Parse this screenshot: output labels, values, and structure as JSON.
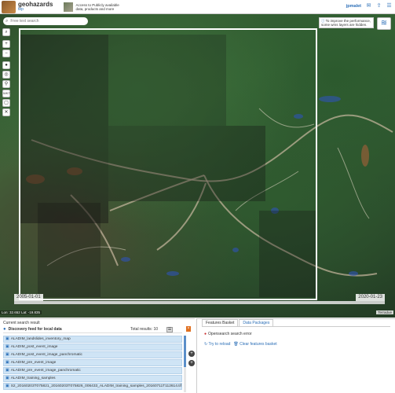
{
  "header": {
    "brand_title": "geohazards",
    "brand_subtitle": "tep",
    "tagline": "Access to Publicly available data, products and more",
    "username": "jpmalet",
    "icons": [
      "envelope-icon",
      "share-icon",
      "menu-icon"
    ]
  },
  "map": {
    "search_placeholder": "Free text search",
    "toolbar": [
      "zoom-in-icon",
      "zoom-out-icon",
      "home-icon",
      "location-icon",
      "marker-icon",
      "wkt-icon",
      "draw-icon",
      "clear-icon"
    ],
    "wkt_label": "WKT",
    "perf_note": "To improve the performance, some wms layers are hidden.",
    "timeline": {
      "start": "2005-01-01",
      "end": "2020-01-23"
    },
    "coords": "Lon: 32.652 Lat: -19.835",
    "terrain_label": "Terradue"
  },
  "left_panel": {
    "title": "Current search result",
    "heading": "Discovery feed for local data",
    "total": "Total results: 10",
    "menu_glyph": "☰",
    "close_glyph": "×",
    "results": [
      "ALADIM_landslides_inventory_map",
      "ALADIM_post_event_image",
      "ALADIM_post_event_image_panchromatic",
      "ALADIM_pre_event_image",
      "ALADIM_pre_event_image_panchromatic",
      "ALADIM_training_samples",
      "S2_20160203T075821_20160203T075826_006433_ALADIM_training_samples_20160711T112614.tif"
    ]
  },
  "right_panel": {
    "tabs": [
      "Features Basket",
      "Data Packages"
    ],
    "error_text": "Opensearch search error",
    "actions": [
      "Try to reload",
      "Clear features basket"
    ],
    "side_buttons": [
      "+",
      "+"
    ]
  },
  "colors": {
    "accent": "#2c6fb7",
    "row_bg": "#cfe4f5",
    "error": "#c62828",
    "orange": "#e07020"
  }
}
